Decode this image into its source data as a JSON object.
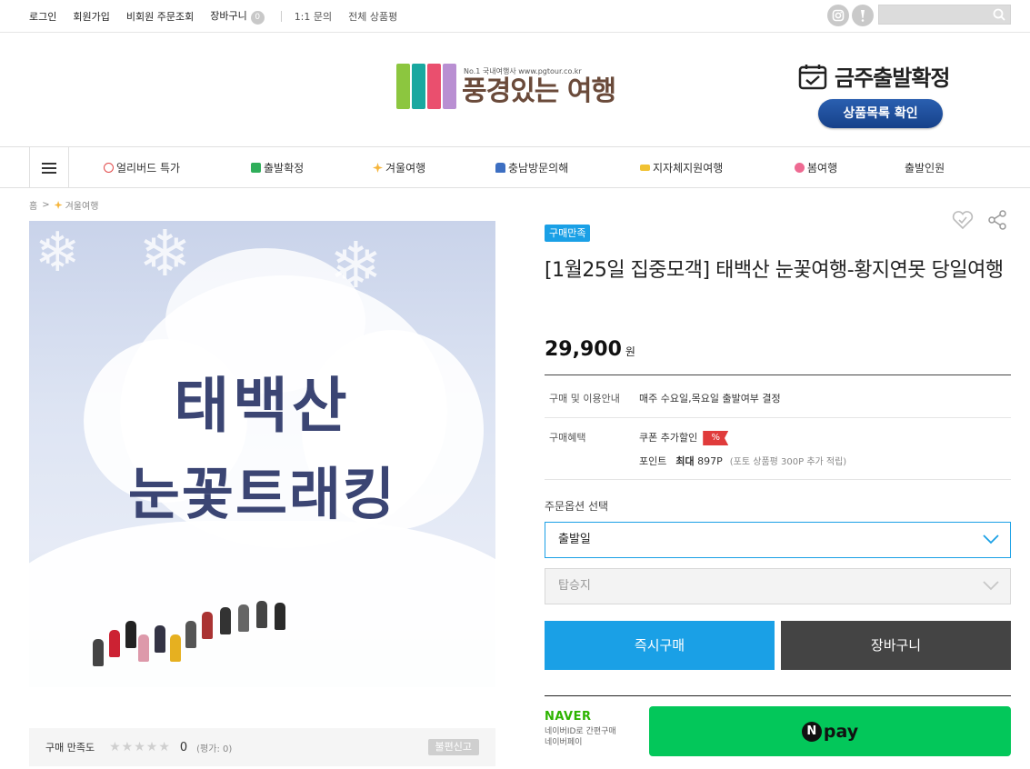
{
  "topnav": {
    "items": [
      "로그인",
      "회원가입",
      "비회원 주문조회",
      "장바구니"
    ],
    "cart_count": "0",
    "links": [
      "1:1 문의",
      "전체 상품평"
    ]
  },
  "social": {
    "icons": [
      "instagram-icon",
      "kakao-icon"
    ]
  },
  "search": {
    "placeholder": ""
  },
  "header": {
    "logo_sub": "No.1 국내여행사 www.pgtour.co.kr",
    "logo_main": "풍경있는 여행",
    "promo_title": "금주출발확정",
    "promo_button": "상품목록 확인"
  },
  "mainnav": {
    "items": [
      "얼리버드 특가",
      "출발확정",
      "겨울여행",
      "충남방문의해",
      "지자체지원여행",
      "봄여행",
      "출발인원"
    ]
  },
  "breadcrumb": {
    "home": "홈",
    "category": "겨울여행"
  },
  "photo": {
    "line1": "태백산",
    "line2": "눈꽃트래킹"
  },
  "rating": {
    "label": "구매 만족도",
    "count": "0",
    "sub": "(평가: 0)",
    "report": "불편신고",
    "stars": 0
  },
  "product": {
    "badge": "구매만족",
    "title": "[1월25일 집중모객] 태백산 눈꽃여행-황지연못 당일여행",
    "price": "29,900",
    "price_unit": "원",
    "info_label": "구매 및 이용안내",
    "info_value": "매주 수요일,목요일 출발여부 결정",
    "benefit_label": "구매혜택",
    "coupon_text": "쿠폰 추가할인",
    "coupon_badge": "%",
    "point_label": "포인트",
    "point_max": "최대",
    "point_value": "897P",
    "point_note": "(포토 상품평 300P 추가 적립)",
    "option_label": "주문옵션 선택",
    "option1": "출발일",
    "option2": "탑승지",
    "buy_now": "즉시구매",
    "add_cart": "장바구니"
  },
  "naver": {
    "logo": "NAVER",
    "sub1": "네이버ID로 간편구매",
    "sub2": "네이버페이",
    "pay": "pay"
  },
  "colors": {
    "accent": "#1aa0e6",
    "cart": "#444444",
    "npay": "#03c75a",
    "naver": "#2db400"
  }
}
